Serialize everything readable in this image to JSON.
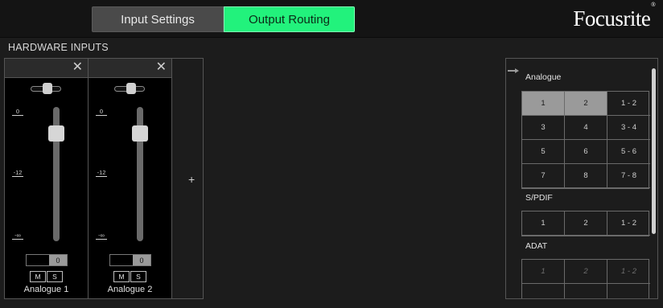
{
  "tabs": [
    {
      "label": "Input Settings"
    },
    {
      "label": "Output Routing"
    }
  ],
  "logo": {
    "text": "Focusrite",
    "mark": "®"
  },
  "hardware_inputs": {
    "title": "HARDWARE INPUTS",
    "close_glyph": "✕",
    "add_glyph": "+",
    "scale": [
      "0",
      "-12",
      "-∞"
    ],
    "strips": [
      {
        "name": "Analogue 1",
        "gain_value": "0",
        "mute": "M",
        "solo": "S"
      },
      {
        "name": "Analogue 2",
        "gain_value": "0",
        "mute": "M",
        "solo": "S"
      }
    ]
  },
  "routing": {
    "groups": [
      {
        "label": "Analogue",
        "rows": [
          [
            "1",
            "2",
            "1 - 2"
          ],
          [
            "3",
            "4",
            "3 - 4"
          ],
          [
            "5",
            "6",
            "5 - 6"
          ],
          [
            "7",
            "8",
            "7 - 8"
          ]
        ]
      },
      {
        "label": "S/PDIF",
        "rows": [
          [
            "1",
            "2",
            "1 - 2"
          ]
        ]
      },
      {
        "label": "ADAT",
        "rows": [
          [
            "1",
            "2",
            "1 - 2"
          ]
        ]
      }
    ]
  }
}
